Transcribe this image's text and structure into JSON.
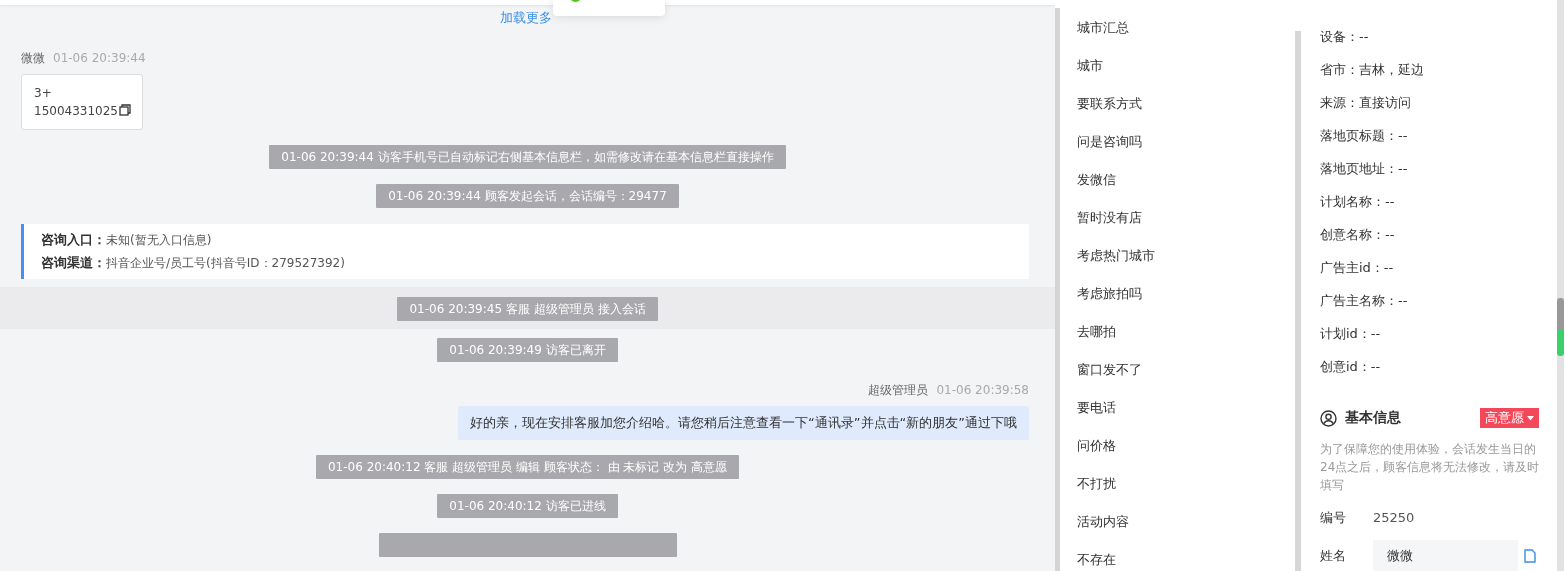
{
  "chat": {
    "load_more": "加载更多",
    "messages": [
      {
        "kind": "customer",
        "sender": "微微",
        "time": "01-06 20:39:44",
        "lines": [
          "3+",
          "15004331025"
        ]
      },
      {
        "kind": "system",
        "text": "01-06 20:39:44 访客手机号已自动标记右侧基本信息栏，如需修改请在基本信息栏直接操作",
        "highlighted": false
      },
      {
        "kind": "system",
        "text": "01-06 20:39:44 顾客发起会话，会话编号：29477",
        "highlighted": false
      },
      {
        "kind": "info",
        "rows": [
          {
            "label": "咨询入口：",
            "value": "未知(暂无入口信息)"
          },
          {
            "label": "咨询渠道：",
            "value": "抖音企业号/员工号(抖音号ID：279527392)"
          }
        ]
      },
      {
        "kind": "system",
        "text": "01-06 20:39:45 客服 超级管理员 接入会话",
        "highlighted": true
      },
      {
        "kind": "system",
        "text": "01-06 20:39:49 访客已离开",
        "highlighted": false
      },
      {
        "kind": "agent",
        "sender": "超级管理员",
        "time": "01-06 20:39:58",
        "text": "好的亲，现在安排客服加您介绍哈。请您稍后注意查看一下“通讯录”并点击“新的朋友”通过下哦"
      },
      {
        "kind": "system",
        "text": "01-06 20:40:12 客服 超级管理员 编辑 顾客状态： 由 未标记 改为 高意愿",
        "highlighted": false
      },
      {
        "kind": "system",
        "text": "01-06 20:40:12 访客已进线",
        "highlighted": false
      }
    ]
  },
  "quick_replies": [
    "城市汇总",
    "城市",
    "要联系方式",
    "问是咨询吗",
    "发微信",
    "暂时没有店",
    "考虑热门城市",
    "考虑旅拍吗",
    "去哪拍",
    "窗口发不了",
    "要电话",
    "问价格",
    "不打扰",
    "活动内容",
    "不存在"
  ],
  "source_info": {
    "lines": [
      "设备：--",
      "省市：吉林，延边",
      "来源：直接访问",
      "落地页标题：--",
      "落地页地址：--",
      "计划名称：--",
      "创意名称：--",
      "广告主id：--",
      "广告主名称：--",
      "计划id：--",
      "创意id：--"
    ]
  },
  "basic_info": {
    "title": "基本信息",
    "status": "高意愿",
    "notice": "为了保障您的使用体验，会话发生当日的24点之后，顾客信息将无法修改，请及时填写",
    "fields": [
      {
        "kind": "text",
        "label": "编号",
        "value": "25250"
      },
      {
        "kind": "input",
        "label": "姓名",
        "value": "微微"
      }
    ]
  }
}
